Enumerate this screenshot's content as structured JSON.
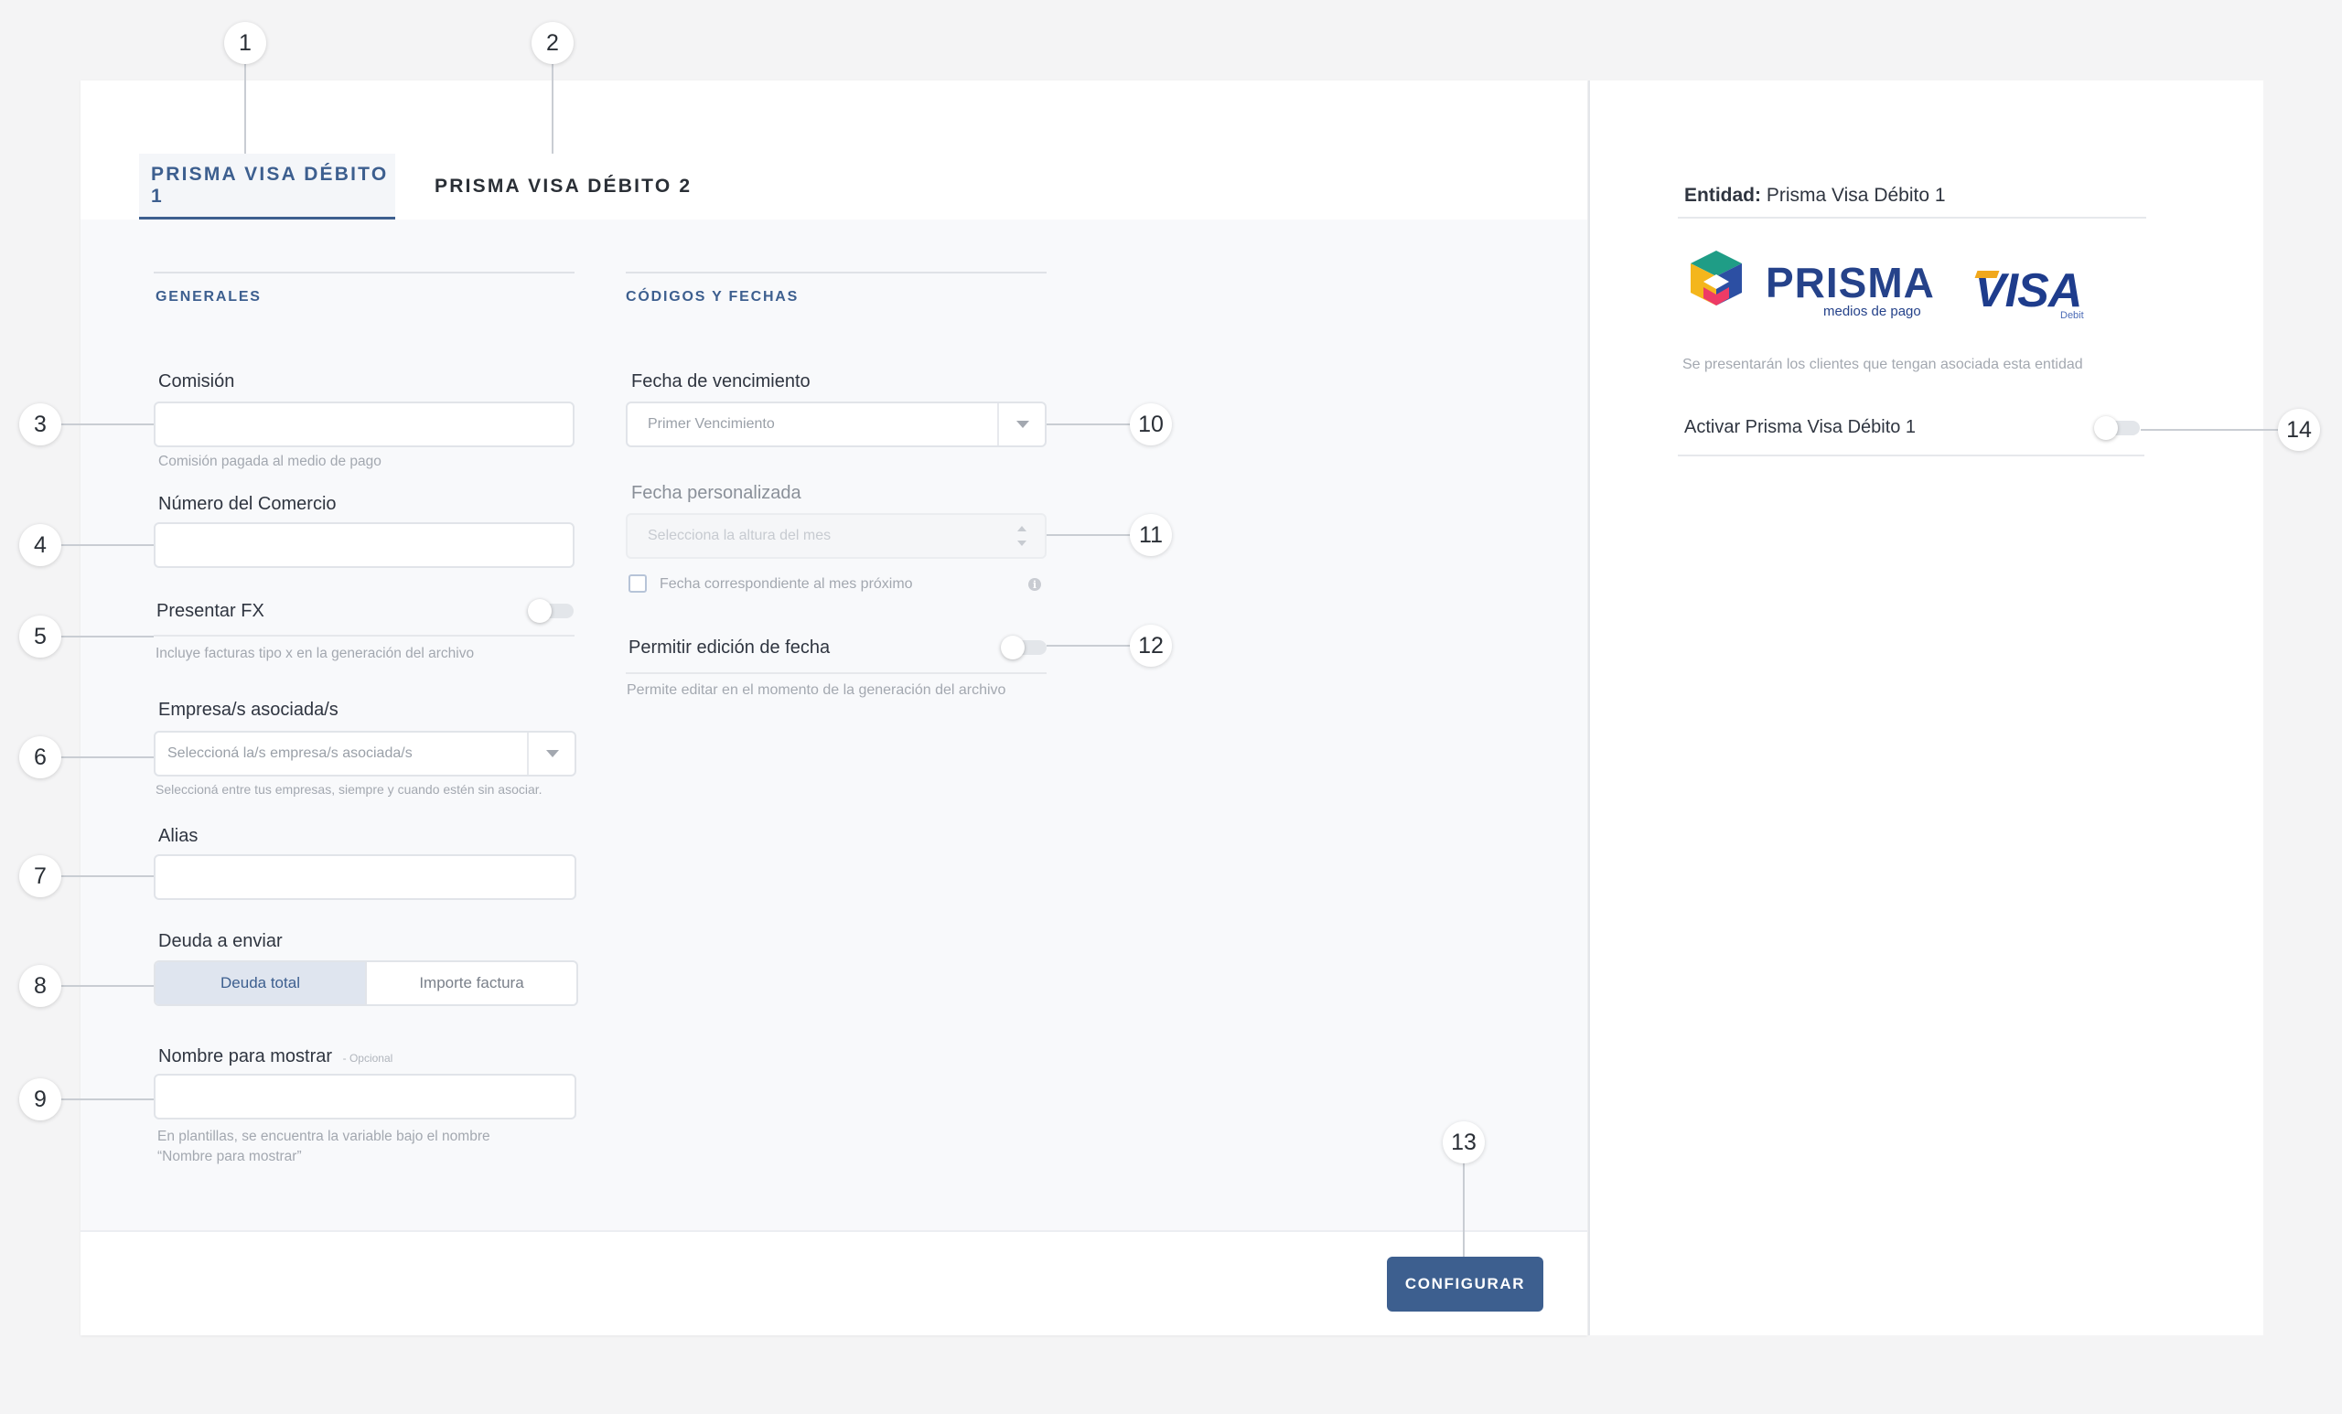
{
  "tabs": [
    {
      "label": "PRISMA VISA DÉBITO 1",
      "active": true
    },
    {
      "label": "PRISMA VISA DÉBITO 2",
      "active": false
    }
  ],
  "generales": {
    "title": "GENERALES",
    "comision": {
      "label": "Comisión",
      "value": "",
      "help": "Comisión pagada al medio de pago"
    },
    "numero_comercio": {
      "label": "Número del Comercio",
      "value": ""
    },
    "presentar_fx": {
      "label": "Presentar FX",
      "enabled": false,
      "help": "Incluye facturas tipo x en la generación del archivo"
    },
    "empresas": {
      "label": "Empresa/s asociada/s",
      "placeholder": "Seleccioná la/s empresa/s asociada/s",
      "help": "Seleccioná entre tus empresas, siempre y cuando estén sin asociar."
    },
    "alias": {
      "label": "Alias",
      "value": ""
    },
    "deuda": {
      "label": "Deuda a enviar",
      "options": [
        "Deuda total",
        "Importe factura"
      ],
      "selected": "Deuda total"
    },
    "nombre_mostrar": {
      "label": "Nombre para mostrar",
      "optional_tag": "- Opcional",
      "value": "",
      "help_line1": "En plantillas, se encuentra la variable bajo el nombre",
      "help_line2": "“Nombre para mostrar”"
    }
  },
  "codigos": {
    "title": "CÓDIGOS Y FECHAS",
    "fecha_vencimiento": {
      "label": "Fecha de vencimiento",
      "placeholder": "Primer Vencimiento"
    },
    "fecha_personalizada": {
      "label": "Fecha personalizada",
      "placeholder": "Selecciona la altura del mes",
      "disabled": true
    },
    "mes_proximo": {
      "label": "Fecha correspondiente al mes próximo",
      "checked": false,
      "info_icon": "info-icon"
    },
    "permitir_edicion": {
      "label": "Permitir edición de fecha",
      "enabled": false,
      "help": "Permite editar en el momento de la generación del archivo"
    }
  },
  "footer": {
    "configure_label": "CONFIGURAR"
  },
  "side": {
    "entity_key": "Entidad:",
    "entity_value": "Prisma Visa Débito 1",
    "prisma_logo_text": "PRISMA",
    "prisma_logo_sub": "medios de pago",
    "visa_logo_text": "VISA",
    "visa_logo_sub": "Debit",
    "note": "Se presentarán los clientes que tengan asociada esta entidad",
    "activate": {
      "label": "Activar Prisma Visa Débito 1",
      "enabled": false
    }
  },
  "markers": [
    "1",
    "2",
    "3",
    "4",
    "5",
    "6",
    "7",
    "8",
    "9",
    "10",
    "11",
    "12",
    "13",
    "14"
  ],
  "colors": {
    "accent": "#3d5f8f",
    "background": "#f4f4f5",
    "form_bg": "#f8f9fb",
    "segment_active": "#dfe5ef"
  }
}
